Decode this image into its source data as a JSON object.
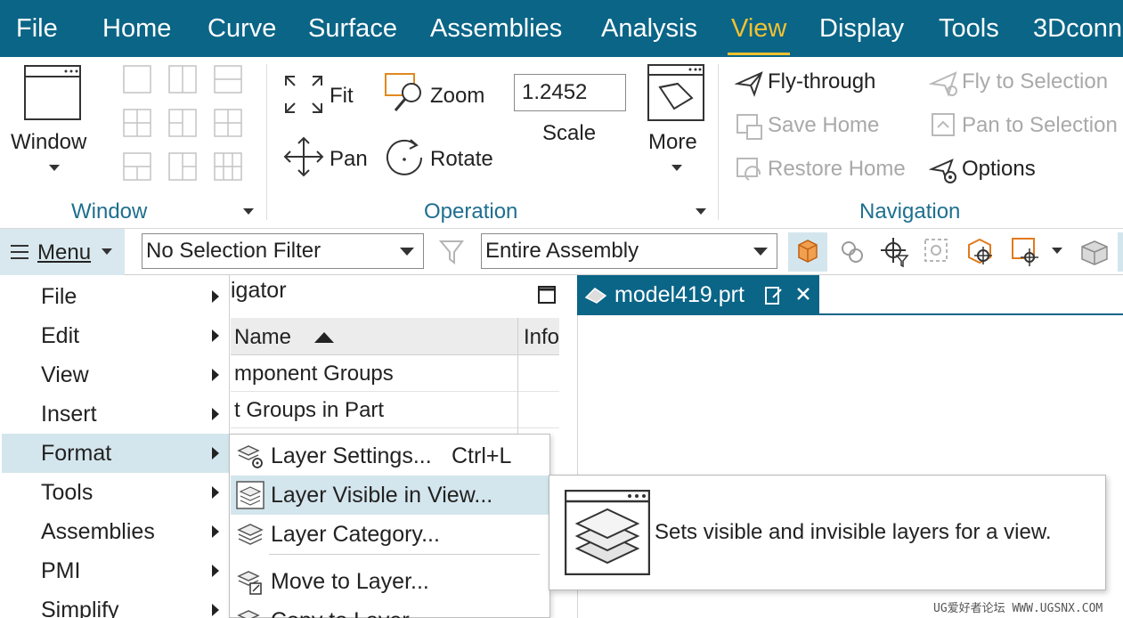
{
  "menubar": {
    "tabs": [
      {
        "label": "File"
      },
      {
        "label": "Home"
      },
      {
        "label": "Curve"
      },
      {
        "label": "Surface"
      },
      {
        "label": "Assemblies"
      },
      {
        "label": "Analysis"
      },
      {
        "label": "View",
        "active": true
      },
      {
        "label": "Display"
      },
      {
        "label": "Tools"
      },
      {
        "label": "3Dconn"
      }
    ]
  },
  "ribbon": {
    "window_group": {
      "button_label": "Window",
      "group_label": "Window"
    },
    "operation_group": {
      "fit_label": "Fit",
      "zoom_label": "Zoom",
      "pan_label": "Pan",
      "rotate_label": "Rotate",
      "scale_value": "1.2452",
      "scale_label": "Scale",
      "more_label": "More",
      "group_label": "Operation"
    },
    "navigation_group": {
      "fly_through": "Fly-through",
      "save_home": "Save Home",
      "restore_home": "Restore Home",
      "fly_to_selection": "Fly to Selection",
      "pan_to_selection": "Pan to Selection",
      "options": "Options",
      "group_label": "Navigation"
    }
  },
  "toolbar": {
    "menu_label": "Menu",
    "selection_filter": "No Selection Filter",
    "scope": "Entire Assembly"
  },
  "navigator": {
    "title_fragment": "igator",
    "col_name": "Name",
    "col_info": "Info",
    "rows": [
      "mponent Groups",
      "t Groups in Part"
    ]
  },
  "document": {
    "tab_label": "model419.prt"
  },
  "main_menu": {
    "items": [
      {
        "label": "File"
      },
      {
        "label": "Edit"
      },
      {
        "label": "View"
      },
      {
        "label": "Insert"
      },
      {
        "label": "Format",
        "highlighted": true
      },
      {
        "label": "Tools"
      },
      {
        "label": "Assemblies"
      },
      {
        "label": "PMI"
      },
      {
        "label": "Simplify"
      }
    ]
  },
  "format_submenu": {
    "items": [
      {
        "label": "Layer Settings...",
        "shortcut": "Ctrl+L"
      },
      {
        "label": "Layer Visible in View...",
        "highlighted": true
      },
      {
        "label": "Layer Category..."
      },
      {
        "label": "Move to Layer..."
      },
      {
        "label": "Copy to Layer..."
      }
    ]
  },
  "tooltip": {
    "text": "Sets visible and invisible layers for a view."
  },
  "watermark": "UG爱好者论坛 WWW.UGSNX.COM",
  "colors": {
    "menubar": "#0a6587",
    "active_tab": "#f2c230",
    "group_label": "#1e6f8f",
    "highlight": "#d4e6ed"
  }
}
